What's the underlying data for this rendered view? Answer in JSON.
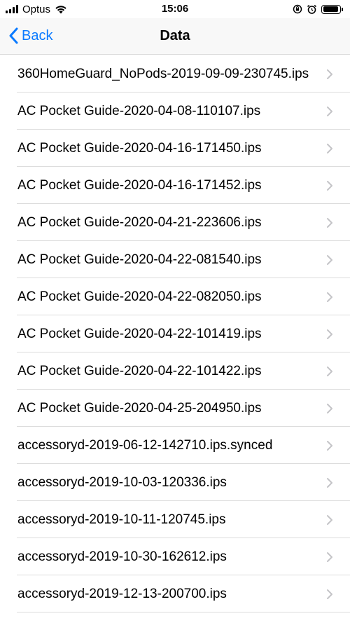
{
  "status_bar": {
    "carrier": "Optus",
    "time": "15:06",
    "icons": [
      "signal-icon",
      "wifi-icon",
      "orientation-lock-icon",
      "alarm-icon",
      "battery-icon"
    ]
  },
  "nav": {
    "back_label": "Back",
    "title": "Data",
    "accent_color": "#0a7aff"
  },
  "files": [
    "360HomeGuard_NoPods-2019-09-09-230745.ips",
    "AC Pocket Guide-2020-04-08-110107.ips",
    "AC Pocket Guide-2020-04-16-171450.ips",
    "AC Pocket Guide-2020-04-16-171452.ips",
    "AC Pocket Guide-2020-04-21-223606.ips",
    "AC Pocket Guide-2020-04-22-081540.ips",
    "AC Pocket Guide-2020-04-22-082050.ips",
    "AC Pocket Guide-2020-04-22-101419.ips",
    "AC Pocket Guide-2020-04-22-101422.ips",
    "AC Pocket Guide-2020-04-25-204950.ips",
    "accessoryd-2019-06-12-142710.ips.synced",
    "accessoryd-2019-10-03-120336.ips",
    "accessoryd-2019-10-11-120745.ips",
    "accessoryd-2019-10-30-162612.ips",
    "accessoryd-2019-12-13-200700.ips"
  ]
}
